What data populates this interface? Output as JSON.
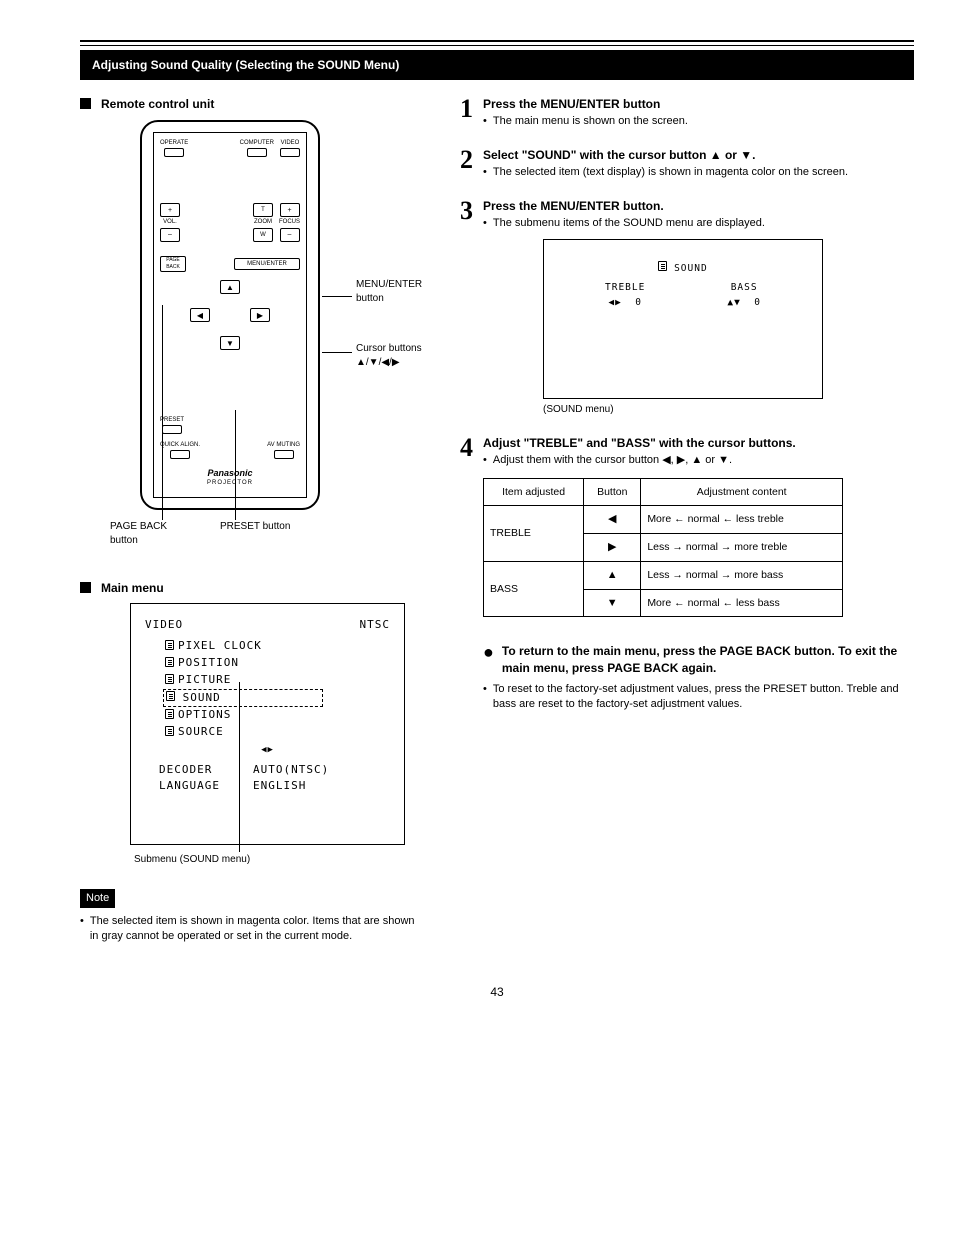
{
  "header": "Adjusting Sound Quality (Selecting the SOUND Menu)",
  "left": {
    "remote_label": "Remote control unit",
    "mainmenu_label": "Main menu",
    "note_label": "Note",
    "note_text": "The selected item is shown in magenta color. Items that are shown in gray cannot be operated or set in the current mode.",
    "remote": {
      "operate": "OPERATE",
      "computer": "COMPUTER",
      "video": "VIDEO",
      "vol": "VOL.",
      "zoom": "ZOOM",
      "zoom_t": "T",
      "zoom_w": "W",
      "focus": "FOCUS",
      "plus": "+",
      "minus": "–",
      "page_back": "PAGE BACK",
      "menu_enter": "MENU/ENTER",
      "preset": "PRESET",
      "quick_align": "QUICK ALIGN.",
      "av_muting": "AV MUTING",
      "brand": "Panasonic",
      "device": "PROJECTOR",
      "leader_menu": "MENU/ENTER button",
      "leader_cursor": "Cursor buttons",
      "leader_pageback": "PAGE BACK button",
      "leader_preset": "PRESET button"
    },
    "mainmenu": {
      "video": "VIDEO",
      "ntsc": "NTSC",
      "items": [
        "PIXEL CLOCK",
        "POSITION",
        "PICTURE",
        "SOUND",
        "OPTIONS",
        "SOURCE"
      ],
      "decoder": "DECODER",
      "decoder_val": "AUTO(NTSC)",
      "language": "LANGUAGE",
      "language_val": "ENGLISH",
      "submenu_label": "Submenu (SOUND menu)"
    }
  },
  "steps": {
    "s1": {
      "title": "Press the MENU/ENTER button",
      "sub": "The main menu is shown on the screen."
    },
    "s2": {
      "title": "Select \"SOUND\" with the cursor button ▲ or ▼.",
      "sub": "The selected item (text display) is shown in magenta color on the screen."
    },
    "s3": {
      "title": "Press the MENU/ENTER button.",
      "sub": "The submenu items of the SOUND menu are displayed.",
      "sound_title": "SOUND",
      "treble": "TREBLE",
      "bass": "BASS",
      "zero": "0",
      "caption": "(SOUND menu)"
    },
    "s4": {
      "title": "Adjust \"TREBLE\" and \"BASS\" with the cursor buttons.",
      "sub": "Adjust them with the cursor button ◀, ▶, ▲ or ▼."
    },
    "table": {
      "h1": "Item adjusted",
      "h2": "Button",
      "h3": "Adjustment content",
      "treble": "TREBLE",
      "bass": "BASS",
      "t_less": "More ← normal ← less treble",
      "t_more": "Less → normal → more treble",
      "b_more": "Less → normal → more bass",
      "b_less": "More ← normal ← less bass"
    },
    "reset": {
      "title": "To return to the main menu, press the PAGE BACK button. To exit the main menu, press PAGE BACK again.",
      "sub": "To reset to the factory-set adjustment values, press the PRESET button. Treble and bass are reset to the factory-set adjustment values."
    }
  },
  "page": "43"
}
